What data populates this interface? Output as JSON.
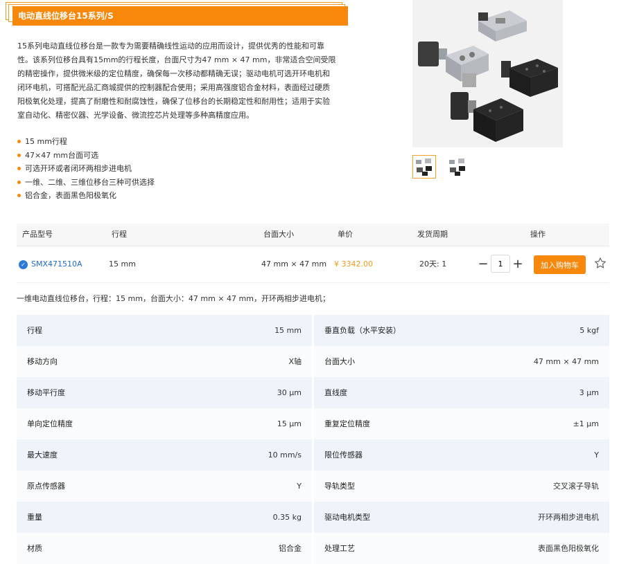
{
  "title": "电动直线位移台15系列/S",
  "description": "15系列电动直线位移台是一款专为需要精确线性运动的应用而设计，提供优秀的性能和可靠性。该系列位移台具有15mm的行程长度，台面尺寸为47 mm × 47 mm，非常适合空间受限的精密操作，提供微米级的定位精度，确保每一次移动都精确无误；驱动电机可选开环电机和闭环电机，可搭配光品汇商城提供的控制器配合使用；采用高强度铝合金材料，表面经过硬质阳极氧化处理，提高了耐磨性和耐腐蚀性，确保了位移台的长期稳定性和耐用性；适用于实验室自动化、精密仪器、光学设备、微流控芯片处理等多种高精度应用。",
  "features": [
    "15 mm行程",
    "47×47 mm台面可选",
    "可选开环或者闭环两相步进电机",
    "一维、二维、三维位移台三种可供选择",
    "铝合金，表面黑色阳极氧化"
  ],
  "table": {
    "headers": {
      "model": "产品型号",
      "travel": "行程",
      "size": "台面大小",
      "price": "单价",
      "delivery": "发货周期",
      "action": "操作"
    },
    "row": {
      "model": "SMX471510A",
      "travel": "15 mm",
      "size": "47 mm × 47 mm",
      "price": "¥ 3342.00",
      "delivery": "20天: 1",
      "quantity": "1",
      "cart_label": "加入购物车"
    }
  },
  "summary": "一维电动直线位移台，行程：15 mm，台面大小：47 mm × 47 mm，开环两相步进电机；",
  "specs": [
    {
      "l_label": "行程",
      "l_value": "15 mm",
      "r_label": "垂直负载（水平安装）",
      "r_value": "5 kgf"
    },
    {
      "l_label": "移动方向",
      "l_value": "X轴",
      "r_label": "台面大小",
      "r_value": "47 mm × 47 mm"
    },
    {
      "l_label": "移动平行度",
      "l_value": "30 μm",
      "r_label": "直线度",
      "r_value": "3 μm"
    },
    {
      "l_label": "单向定位精度",
      "l_value": "15 μm",
      "r_label": "重复定位精度",
      "r_value": "±1 μm"
    },
    {
      "l_label": "最大速度",
      "l_value": "10 mm/s",
      "r_label": "限位传感器",
      "r_value": "Y"
    },
    {
      "l_label": "原点传感器",
      "l_value": "Y",
      "r_label": "导轨类型",
      "r_value": "交叉滚子导轨"
    },
    {
      "l_label": "重量",
      "l_value": "0.35 kg",
      "r_label": "驱动电机类型",
      "r_value": "开环两相步进电机"
    },
    {
      "l_label": "材质",
      "l_value": "铝合金",
      "r_label": "处理工艺",
      "r_value": "表面黑色阳极氧化"
    }
  ],
  "colors": {
    "accent": "#f7880b",
    "link": "#1e6bd1",
    "price": "#f39a1c",
    "spec_shade": "#eef4fa"
  },
  "icons": {
    "model_status": "check-circle-icon",
    "favorite": "star-outline-icon",
    "minus": "minus-icon",
    "plus": "plus-icon"
  }
}
